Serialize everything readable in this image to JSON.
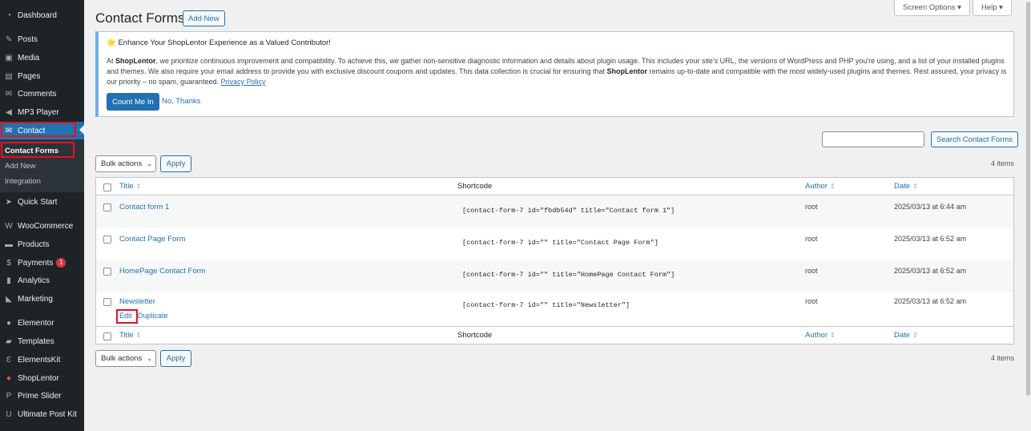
{
  "sidebar": {
    "items": [
      {
        "label": "Dashboard",
        "icon": "dashboard-icon",
        "glyph": "◔"
      },
      {
        "label": "Posts",
        "icon": "pin-icon",
        "glyph": "✎"
      },
      {
        "label": "Media",
        "icon": "media-icon",
        "glyph": "▣"
      },
      {
        "label": "Pages",
        "icon": "pages-icon",
        "glyph": "▤"
      },
      {
        "label": "Comments",
        "icon": "comments-icon",
        "glyph": "✉"
      },
      {
        "label": "MP3 Player",
        "icon": "speaker-icon",
        "glyph": "◀"
      },
      {
        "label": "Contact",
        "icon": "mail-icon",
        "glyph": "✉"
      },
      {
        "label": "Quick Start",
        "icon": "rocket-icon",
        "glyph": "➤"
      },
      {
        "label": "WooCommerce",
        "icon": "woo-icon",
        "glyph": "W"
      },
      {
        "label": "Products",
        "icon": "archive-icon",
        "glyph": "▬"
      },
      {
        "label": "Payments",
        "icon": "dollar-icon",
        "glyph": "$",
        "badge": "1"
      },
      {
        "label": "Analytics",
        "icon": "bar-chart-icon",
        "glyph": "▮"
      },
      {
        "label": "Marketing",
        "icon": "megaphone-icon",
        "glyph": "◣"
      },
      {
        "label": "Elementor",
        "icon": "elementor-icon",
        "glyph": "●"
      },
      {
        "label": "Templates",
        "icon": "folder-icon",
        "glyph": "▰"
      },
      {
        "label": "ElementsKit",
        "icon": "elementskit-icon",
        "glyph": "Ɛ"
      },
      {
        "label": "ShopLentor",
        "icon": "shoplentor-icon",
        "glyph": "●"
      },
      {
        "label": "Prime Slider",
        "icon": "prime-slider-icon",
        "glyph": "P"
      },
      {
        "label": "Ultimate Post Kit",
        "icon": "post-kit-icon",
        "glyph": "U"
      }
    ],
    "submenu": [
      "Contact Forms",
      "Add New",
      "Integration"
    ]
  },
  "header": {
    "title": "Contact Forms",
    "add_new": "Add New",
    "screen_options": "Screen Options ▾",
    "help": "Help ▾"
  },
  "notice": {
    "title": "🌟 Enhance Your ShopLentor Experience as a Valued Contributor!",
    "body_pre": "At ",
    "brand": "ShopLentor",
    "body_mid": ", we prioritize continuous improvement and compatibility. To achieve this, we gather non-sensitive diagnostic information and details about plugin usage. This includes your site's URL, the versions of WordPress and PHP you're using, and a list of your installed plugins and themes. We also require your email address to provide you with exclusive discount coupons and updates. This data collection is crucial for ensuring that ",
    "brand2": "ShopLentor",
    "body_post": " remains up-to-date and compatible with the most widely-used plugins and themes. Rest assured, your privacy is our priority – no spam, guaranteed. ",
    "privacy": "Privacy Policy",
    "accept": "Count Me In",
    "decline": "No, Thanks"
  },
  "search": {
    "button": "Search Contact Forms",
    "value": ""
  },
  "bulk": {
    "label": "Bulk actions",
    "apply": "Apply"
  },
  "items_count": "4 items",
  "columns": {
    "title": "Title",
    "shortcode": "Shortcode",
    "author": "Author",
    "date": "Date"
  },
  "rows": [
    {
      "title": "Contact form 1",
      "shortcode": "[contact-form-7 id=\"fbdb54d\" title=\"Contact form 1\"]",
      "author": "root",
      "date": "2025/03/13 at 6:44 am"
    },
    {
      "title": "Contact Page Form",
      "shortcode": "[contact-form-7 id=\"\" title=\"Contact Page Form\"]",
      "author": "root",
      "date": "2025/03/13 at 6:52 am"
    },
    {
      "title": "HomePage Contact Form",
      "shortcode": "[contact-form-7 id=\"\" title=\"HomePage Contact Form\"]",
      "author": "root",
      "date": "2025/03/13 at 6:52 am"
    },
    {
      "title": "Newsletter",
      "shortcode": "[contact-form-7 id=\"\" title=\"Newsletter\"]",
      "author": "root",
      "date": "2025/03/13 at 6:52 am"
    }
  ],
  "row_actions": {
    "edit": "Edit",
    "duplicate": "Duplicate"
  },
  "colors": {
    "accent": "#2271b1",
    "sidebar": "#1d2327",
    "highlight": "#e0141e",
    "badge": "#d63638"
  }
}
